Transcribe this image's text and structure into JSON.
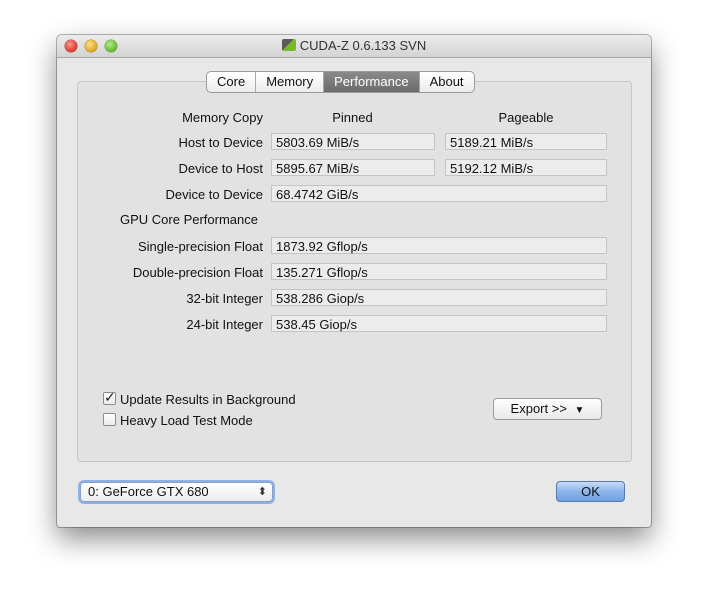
{
  "window": {
    "title": "CUDA-Z 0.6.133 SVN"
  },
  "tabs": [
    {
      "label": "Core",
      "active": false
    },
    {
      "label": "Memory",
      "active": false
    },
    {
      "label": "Performance",
      "active": true
    },
    {
      "label": "About",
      "active": false
    }
  ],
  "memory_copy": {
    "section_label": "Memory Copy",
    "col_pinned": "Pinned",
    "col_pageable": "Pageable",
    "host_to_device": {
      "label": "Host to Device",
      "pinned": "5803.69 MiB/s",
      "pageable": "5189.21 MiB/s"
    },
    "device_to_host": {
      "label": "Device to Host",
      "pinned": "5895.67 MiB/s",
      "pageable": "5192.12 MiB/s"
    },
    "device_to_device": {
      "label": "Device to Device",
      "value": "68.4742 GiB/s"
    }
  },
  "gpu_core": {
    "section_label": "GPU Core Performance",
    "single_float": {
      "label": "Single-precision Float",
      "value": "1873.92 Gflop/s"
    },
    "double_float": {
      "label": "Double-precision Float",
      "value": "135.271 Gflop/s"
    },
    "int32": {
      "label": "32-bit Integer",
      "value": "538.286 Giop/s"
    },
    "int24": {
      "label": "24-bit Integer",
      "value": "538.45 Giop/s"
    }
  },
  "options": {
    "update_background": {
      "label": "Update Results in Background",
      "checked": true,
      "mark": "✓"
    },
    "heavy_load": {
      "label": "Heavy Load Test Mode",
      "checked": false
    }
  },
  "export_button": {
    "label": "Export >>",
    "arrow": "▼"
  },
  "device_select": {
    "value": "0: GeForce GTX 680",
    "arrows": "⬍"
  },
  "ok_button": {
    "label": "OK"
  }
}
